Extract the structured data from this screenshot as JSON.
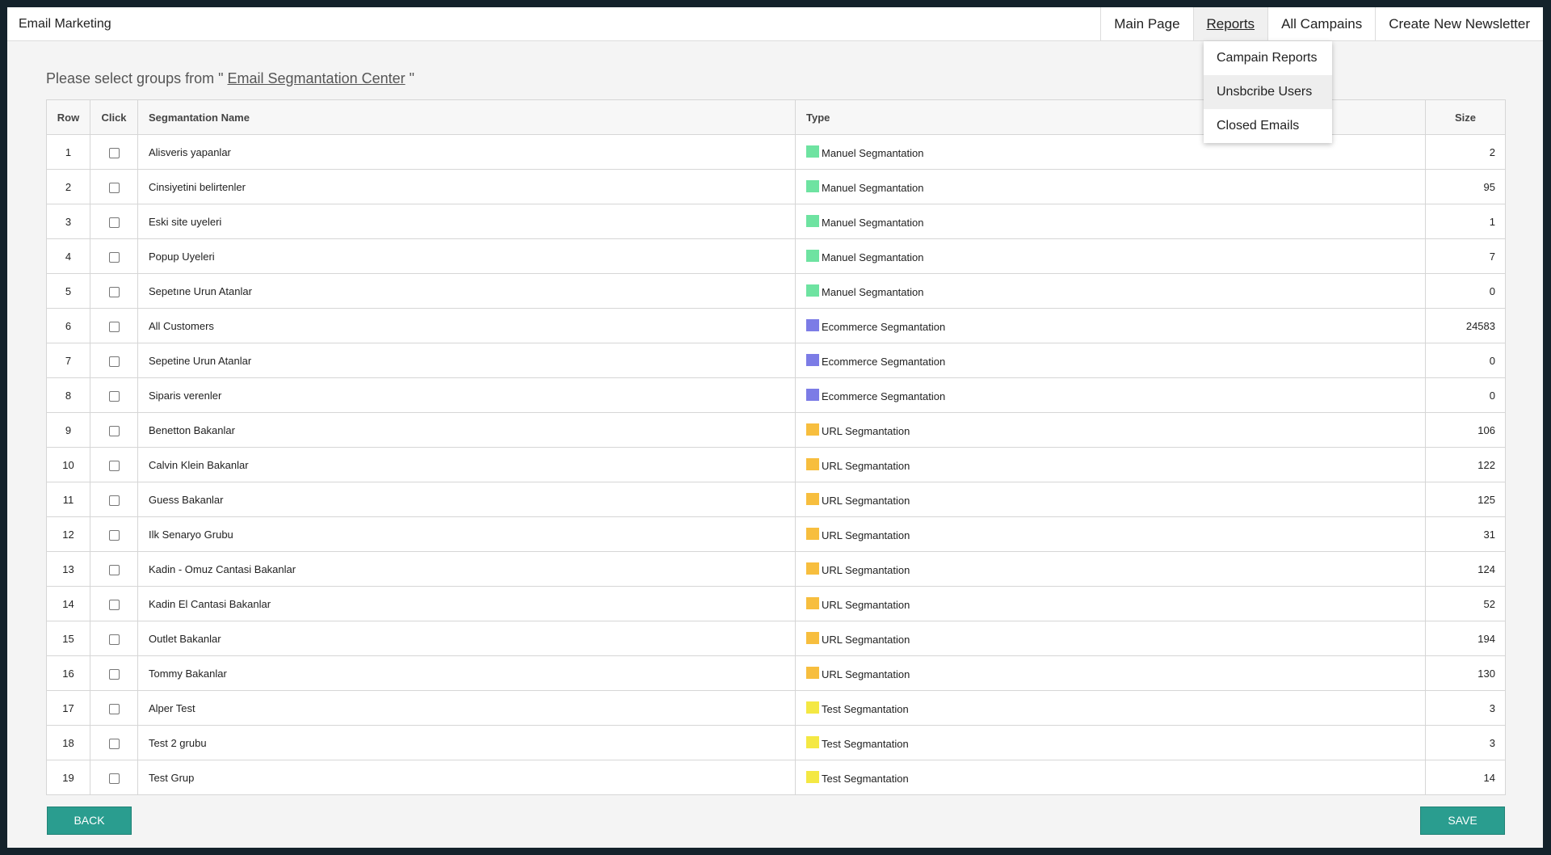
{
  "app": {
    "title": "Email Marketing"
  },
  "nav": {
    "items": [
      {
        "label": "Main Page",
        "active": false
      },
      {
        "label": "Reports",
        "active": true
      },
      {
        "label": "All Campains",
        "active": false
      },
      {
        "label": "Create New Newsletter",
        "active": false
      }
    ],
    "reports_menu": [
      {
        "label": "Campain Reports"
      },
      {
        "label": "Unsbcribe Users",
        "hovered": true
      },
      {
        "label": "Closed Emails"
      }
    ]
  },
  "intro": {
    "prefix": "Please select groups from \" ",
    "link": "Email Segmantation Center",
    "suffix": " \""
  },
  "table": {
    "headers": {
      "row": "Row",
      "click": "Click",
      "name": "Segmantation Name",
      "type": "Type",
      "size": "Size"
    },
    "type_colors": {
      "Manuel Segmantation": "#6ee3a1",
      "Ecommerce Segmantation": "#7c7ce6",
      "URL Segmantation": "#f7be3e",
      "Test Segmantation": "#f4e843"
    },
    "rows": [
      {
        "row": "1",
        "name": "Alisveris yapanlar",
        "type": "Manuel Segmantation",
        "size": "2",
        "checked": false
      },
      {
        "row": "2",
        "name": "Cinsiyetini belirtenler",
        "type": "Manuel Segmantation",
        "size": "95",
        "checked": false
      },
      {
        "row": "3",
        "name": "Eski site uyeleri",
        "type": "Manuel Segmantation",
        "size": "1",
        "checked": false
      },
      {
        "row": "4",
        "name": "Popup Uyeleri",
        "type": "Manuel Segmantation",
        "size": "7",
        "checked": false
      },
      {
        "row": "5",
        "name": "Sepetıne Urun Atanlar",
        "type": "Manuel Segmantation",
        "size": "0",
        "checked": false
      },
      {
        "row": "6",
        "name": "All Customers",
        "type": "Ecommerce Segmantation",
        "size": "24583",
        "checked": false
      },
      {
        "row": "7",
        "name": "Sepetine Urun Atanlar",
        "type": "Ecommerce Segmantation",
        "size": "0",
        "checked": false
      },
      {
        "row": "8",
        "name": "Siparis verenler",
        "type": "Ecommerce Segmantation",
        "size": "0",
        "checked": false
      },
      {
        "row": "9",
        "name": "Benetton Bakanlar",
        "type": "URL Segmantation",
        "size": "106",
        "checked": false
      },
      {
        "row": "10",
        "name": "Calvin Klein Bakanlar",
        "type": "URL Segmantation",
        "size": "122",
        "checked": false
      },
      {
        "row": "11",
        "name": "Guess Bakanlar",
        "type": "URL Segmantation",
        "size": "125",
        "checked": false
      },
      {
        "row": "12",
        "name": "Ilk Senaryo Grubu",
        "type": "URL Segmantation",
        "size": "31",
        "checked": false
      },
      {
        "row": "13",
        "name": "Kadin - Omuz Cantasi Bakanlar",
        "type": "URL Segmantation",
        "size": "124",
        "checked": false
      },
      {
        "row": "14",
        "name": "Kadin El Cantasi Bakanlar",
        "type": "URL Segmantation",
        "size": "52",
        "checked": false
      },
      {
        "row": "15",
        "name": "Outlet Bakanlar",
        "type": "URL Segmantation",
        "size": "194",
        "checked": false
      },
      {
        "row": "16",
        "name": "Tommy Bakanlar",
        "type": "URL Segmantation",
        "size": "130",
        "checked": false
      },
      {
        "row": "17",
        "name": "Alper Test",
        "type": "Test Segmantation",
        "size": "3",
        "checked": false
      },
      {
        "row": "18",
        "name": "Test 2 grubu",
        "type": "Test Segmantation",
        "size": "3",
        "checked": false
      },
      {
        "row": "19",
        "name": "Test Grup",
        "type": "Test Segmantation",
        "size": "14",
        "checked": false
      }
    ]
  },
  "buttons": {
    "back": "BACK",
    "save": "SAVE"
  }
}
